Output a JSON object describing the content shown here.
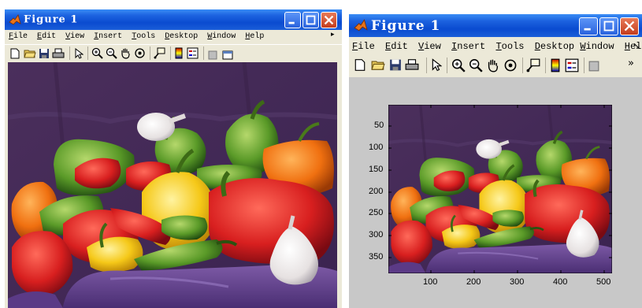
{
  "left_window": {
    "title": "Figure 1",
    "menu": [
      "File",
      "Edit",
      "View",
      "Insert",
      "Tools",
      "Desktop",
      "Window",
      "Help"
    ]
  },
  "right_window": {
    "title": "Figure 1",
    "menu": [
      "File",
      "Edit",
      "View",
      "Insert",
      "Tools",
      "Desktop",
      "Window",
      "Help"
    ],
    "toolbar_overflow": "»",
    "menu_overflow": "↘",
    "y_ticks": [
      "50",
      "100",
      "150",
      "200",
      "250",
      "300",
      "350"
    ],
    "x_ticks": [
      "100",
      "200",
      "300",
      "400",
      "500"
    ]
  },
  "toolbar_icons": [
    "new-file-icon",
    "open-folder-icon",
    "save-icon",
    "print-icon",
    "edit-plot-arrow-icon",
    "zoom-in-icon",
    "zoom-out-icon",
    "pan-hand-icon",
    "rotate-3d-icon",
    "data-cursor-icon",
    "colorbar-icon",
    "legend-icon",
    "hide-plot-tools-icon",
    "show-plot-tools-icon"
  ],
  "colors": {
    "titlebar": "#0a4bd0",
    "window_bg": "#ece9d8",
    "plot_bg": "#c8c8c8"
  }
}
